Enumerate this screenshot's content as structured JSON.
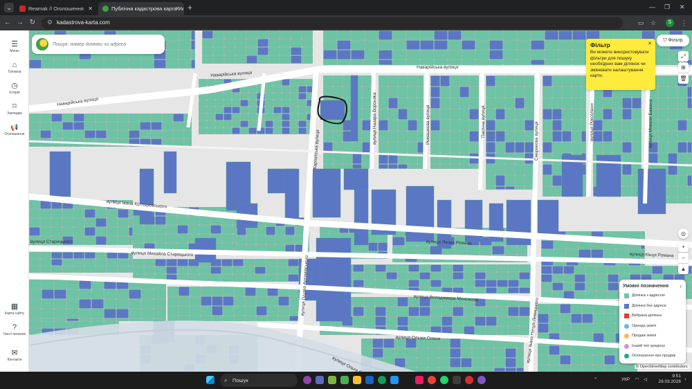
{
  "browser": {
    "tabs": [
      {
        "title": "Reamak // Оголошення",
        "favicon_color": "#c62828"
      },
      {
        "title": "Публічна кадастрова карта Ук",
        "favicon_color": "#43a047"
      }
    ],
    "url": "kadastrova-karta.com",
    "profile_initial": "S"
  },
  "sidebar": {
    "items": [
      {
        "label": "Меню",
        "icon": "menu-icon",
        "glyph": "☰"
      },
      {
        "label": "Головна",
        "icon": "home-icon",
        "glyph": "⌂"
      },
      {
        "label": "Історія",
        "icon": "history-icon",
        "glyph": "◷"
      },
      {
        "label": "Закладки",
        "icon": "bookmark-icon",
        "glyph": "⌑"
      },
      {
        "label": "Оголошення",
        "icon": "megaphone-icon",
        "glyph": "📢"
      }
    ],
    "bottom_items": [
      {
        "label": "Карта сайту",
        "icon": "sitemap-icon",
        "glyph": "▦"
      },
      {
        "label": "Часті питання",
        "icon": "question-icon",
        "glyph": "?"
      },
      {
        "label": "Контакти",
        "icon": "chat-icon",
        "glyph": "✉"
      }
    ]
  },
  "search": {
    "placeholder": "Пошук: номер ділянки чи адреса"
  },
  "filter": {
    "button_label": "Фільтр",
    "tooltip_title": "Фільтр",
    "tooltip_text": "Ви можете використовувати фільтри для пошуку необхідних вам ділянок чи змінювати налаштування карти."
  },
  "map": {
    "streets": [
      "Наварійська вулиця",
      "Наварійська вулиця",
      "Наварійська вулиця",
      "вулиця Назара Вороняка",
      "Ромашкова вулиця",
      "Пасічна вулиця",
      "Смерекова вулиця",
      "вулиця Роксолани",
      "вулиця Миколи Бажана",
      "Карпатська вулиця",
      "вулиця Івана Котляревського",
      "вулиця Михайла Старицького",
      "вулиця Старицького",
      "вулиця Гуцака Артемівського",
      "вулиця Якова Романа",
      "вулиця Кінця Романа",
      "вулиця Володимира Мономаха",
      "вулиця Івана Нечуя-Левицького",
      "вулиця Ольжи Олени",
      "вулиця Ольги Олени"
    ],
    "colors": {
      "parcel_with_address": "#6dc4a4",
      "parcel_without_address": "#5b77c4",
      "selected_parcel": "#e53935",
      "road": "#ffffff",
      "background": "#e8e8e8"
    }
  },
  "map_tools": [
    {
      "name": "locate-icon",
      "glyph": "◎"
    },
    {
      "name": "zoom-in-icon",
      "glyph": "+"
    },
    {
      "name": "zoom-out-icon",
      "glyph": "−"
    },
    {
      "name": "compass-icon",
      "glyph": "▲"
    }
  ],
  "side_tools": [
    {
      "name": "expand-icon",
      "glyph": "⤢"
    },
    {
      "name": "grid-icon",
      "glyph": "⊞"
    },
    {
      "name": "trash-icon",
      "glyph": "🗑"
    }
  ],
  "legend": {
    "title": "Умовні позначення",
    "items": [
      {
        "label": "Ділянка з адресою",
        "color": "#6dc4a4",
        "shape": "square"
      },
      {
        "label": "Ділянка без адреси",
        "color": "#5b77c4",
        "shape": "square"
      },
      {
        "label": "Вибрана ділянка",
        "color": "#e53935",
        "shape": "square"
      },
      {
        "label": "Оренда землі",
        "color": "#64b5f6",
        "shape": "dot"
      },
      {
        "label": "Продаж землі",
        "color": "#ffb74d",
        "shape": "dot"
      },
      {
        "label": "Інший тип аукціону",
        "color": "#ce93d8",
        "shape": "dot"
      },
      {
        "label": "Оголошення про продаж",
        "color": "#26a69a",
        "shape": "dot"
      }
    ]
  },
  "attribution": "© OpenStreetMap contributors",
  "taskbar": {
    "search_label": "Пошук",
    "language": "УКР",
    "time": "9:51",
    "date": "29.03.2026"
  }
}
